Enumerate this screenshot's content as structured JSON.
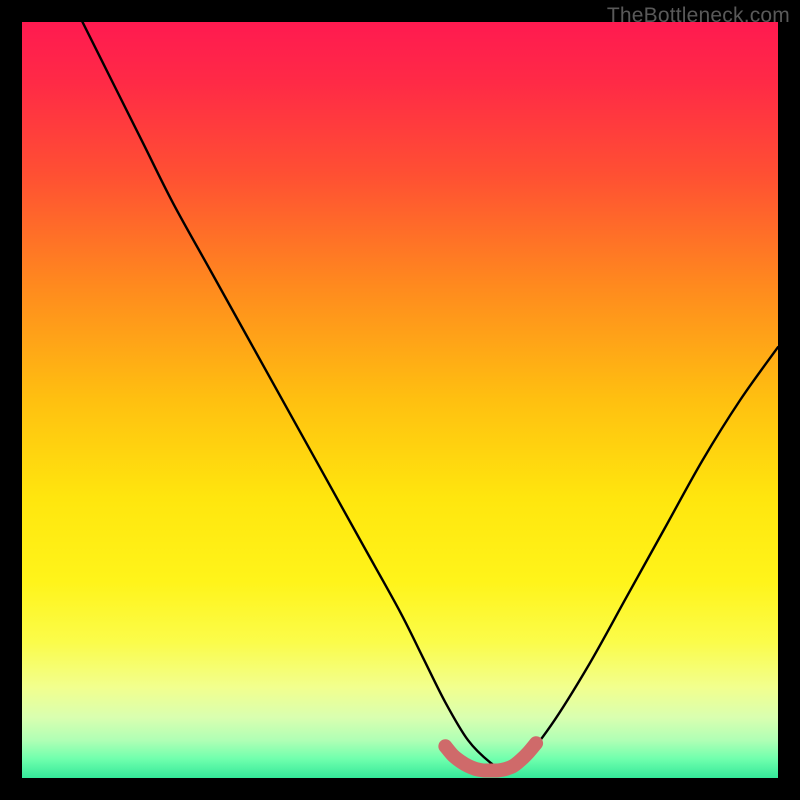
{
  "watermark": {
    "text": "TheBottleneck.com"
  },
  "colors": {
    "black": "#000000",
    "curve_stroke": "#000000",
    "marker_stroke": "#cf6a6a",
    "gradient_stops": [
      {
        "offset": 0.0,
        "color": "#ff1a50"
      },
      {
        "offset": 0.08,
        "color": "#ff2a46"
      },
      {
        "offset": 0.2,
        "color": "#ff4f33"
      },
      {
        "offset": 0.35,
        "color": "#ff8a1e"
      },
      {
        "offset": 0.5,
        "color": "#ffc010"
      },
      {
        "offset": 0.63,
        "color": "#ffe60e"
      },
      {
        "offset": 0.74,
        "color": "#fff41a"
      },
      {
        "offset": 0.82,
        "color": "#fbfc4a"
      },
      {
        "offset": 0.88,
        "color": "#f2ff8e"
      },
      {
        "offset": 0.92,
        "color": "#d9ffb0"
      },
      {
        "offset": 0.95,
        "color": "#b0ffb5"
      },
      {
        "offset": 0.975,
        "color": "#6fffad"
      },
      {
        "offset": 1.0,
        "color": "#34e89a"
      }
    ]
  },
  "chart_data": {
    "type": "line",
    "title": "",
    "xlabel": "",
    "ylabel": "",
    "xlim": [
      0,
      100
    ],
    "ylim": [
      0,
      100
    ],
    "series": [
      {
        "name": "bottleneck-curve",
        "x": [
          8,
          12,
          16,
          20,
          25,
          30,
          35,
          40,
          45,
          50,
          53,
          56,
          59,
          62,
          64,
          66,
          70,
          75,
          80,
          85,
          90,
          95,
          100
        ],
        "y": [
          100,
          92,
          84,
          76,
          67,
          58,
          49,
          40,
          31,
          22,
          16,
          10,
          5,
          2,
          1,
          2,
          7,
          15,
          24,
          33,
          42,
          50,
          57
        ]
      },
      {
        "name": "optimal-region-marker",
        "x": [
          56,
          57,
          58,
          59,
          60,
          61,
          62,
          63,
          64,
          65,
          66,
          67,
          68
        ],
        "y": [
          4.2,
          3.0,
          2.2,
          1.6,
          1.2,
          1.0,
          1.0,
          1.0,
          1.2,
          1.6,
          2.4,
          3.4,
          4.6
        ]
      }
    ],
    "annotations": []
  }
}
